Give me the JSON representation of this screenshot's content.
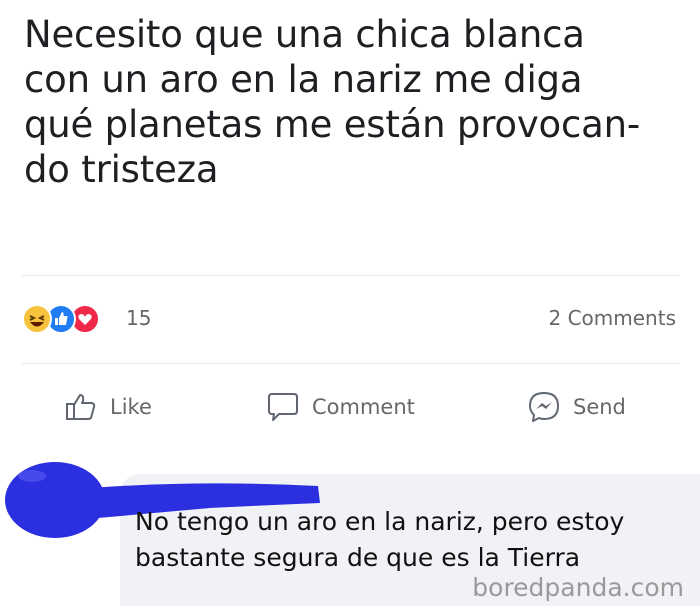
{
  "post": {
    "text_lines": [
      "Necesito que una chica blanca",
      "con un aro en la nariz me diga",
      "qué planetas me están provocan-",
      "do tristeza"
    ]
  },
  "reactions": {
    "icons": [
      "haha-emoji-icon",
      "like-thumb-icon",
      "love-heart-icon"
    ],
    "count": "15",
    "comments_count": "2 Comments"
  },
  "actions": {
    "like_label": "Like",
    "comment_label": "Comment",
    "send_label": "Send"
  },
  "comment": {
    "text_lines": [
      "No tengo un aro en la nariz, pero estoy",
      "bastante segura de que es la Tierra"
    ],
    "avatar_redaction_color": "#2b2fe0"
  },
  "watermark": "boredpanda.com",
  "colors": {
    "like_blue": "#1f7cf3",
    "love_red": "#f0284a",
    "haha_yellow": "#f7c33d",
    "muted_text": "#65676b",
    "comment_bubble": "#f0f2f5"
  }
}
